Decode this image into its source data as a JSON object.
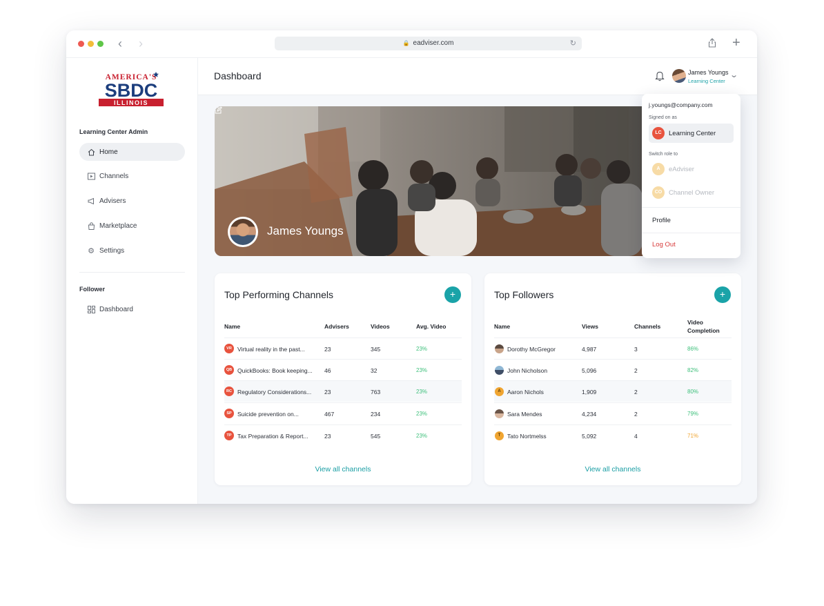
{
  "browser": {
    "url": "eadviser.com"
  },
  "logo": {
    "line1": "AMERICA'S",
    "line2": "SBDC",
    "line3": "ILLINOIS"
  },
  "sidebar": {
    "admin_label": "Learning Center Admin",
    "items": [
      {
        "label": "Home",
        "icon": "home-icon"
      },
      {
        "label": "Channels",
        "icon": "play-icon"
      },
      {
        "label": "Advisers",
        "icon": "megaphone-icon"
      },
      {
        "label": "Marketplace",
        "icon": "bag-icon"
      },
      {
        "label": "Settings",
        "icon": "gear-icon"
      }
    ],
    "follower_label": "Follower",
    "follower_items": [
      {
        "label": "Dashboard",
        "icon": "grid-icon"
      }
    ]
  },
  "header": {
    "title": "Dashboard",
    "user_name": "James Youngs",
    "user_role": "Learning Center"
  },
  "hero": {
    "name": "James Youngs"
  },
  "channels_card": {
    "title": "Top Performing Channels",
    "columns": [
      "Name",
      "Advisers",
      "Videos",
      "Avg. Video"
    ],
    "rows": [
      {
        "badge": "VR",
        "name": "Virtual reality in the past...",
        "advisers": "23",
        "videos": "345",
        "avg": "23%"
      },
      {
        "badge": "QB",
        "name": "QuickBooks: Book keeping...",
        "advisers": "46",
        "videos": "32",
        "avg": "23%"
      },
      {
        "badge": "RC",
        "name": "Regulatory Considerations...",
        "advisers": "23",
        "videos": "763",
        "avg": "23%"
      },
      {
        "badge": "SP",
        "name": "Suicide prevention on...",
        "advisers": "467",
        "videos": "234",
        "avg": "23%"
      },
      {
        "badge": "TP",
        "name": "Tax Preparation & Report...",
        "advisers": "23",
        "videos": "545",
        "avg": "23%"
      }
    ],
    "view_all": "View all channels"
  },
  "followers_card": {
    "title": "Top Followers",
    "columns": [
      "Name",
      "Views",
      "Channels",
      "Video",
      "Completion"
    ],
    "rows": [
      {
        "initial": "",
        "name": "Dorothy McGregor",
        "views": "4,987",
        "channels": "3",
        "completion": "86%"
      },
      {
        "initial": "",
        "name": "John Nicholson",
        "views": "5,096",
        "channels": "2",
        "completion": "82%"
      },
      {
        "initial": "A",
        "name": "Aaron Nichols",
        "views": "1,909",
        "channels": "2",
        "completion": "80%"
      },
      {
        "initial": "",
        "name": "Sara Mendes",
        "views": "4,234",
        "channels": "2",
        "completion": "79%"
      },
      {
        "initial": "T",
        "name": "Tato Nortmelss",
        "views": "5,092",
        "channels": "4",
        "completion": "71%"
      }
    ],
    "view_all": "View all channels"
  },
  "dropdown": {
    "email": "j.youngs@company.com",
    "signed_on_label": "Signed on as",
    "current_role": {
      "badge": "LC",
      "label": "Learning Center"
    },
    "switch_label": "Switch role to",
    "roles": [
      {
        "badge": "A",
        "label": "eAdviser"
      },
      {
        "badge": "CO",
        "label": "Channel Owner"
      }
    ],
    "profile": "Profile",
    "logout": "Log Out"
  },
  "colors": {
    "accent": "#1aa3a8",
    "green": "#3cbf7a",
    "amber": "#f0a531",
    "danger": "#d83a3a",
    "badge_red": "#e8533e"
  }
}
